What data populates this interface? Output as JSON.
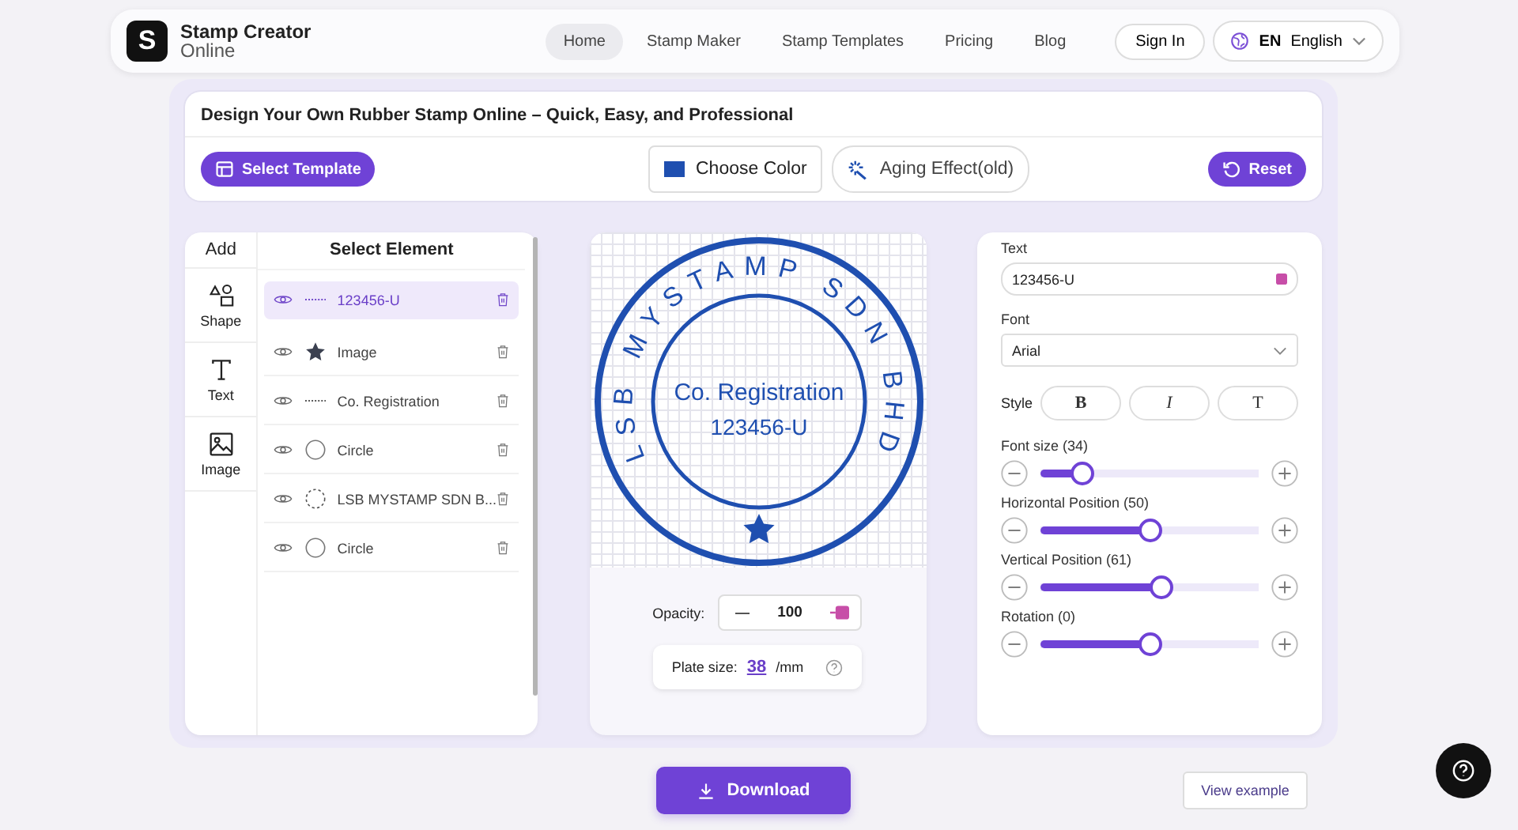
{
  "header": {
    "logo_letter": "S",
    "brand": "Stamp Creator",
    "brand_sub": "Online",
    "nav": [
      {
        "label": "Home",
        "selected": true
      },
      {
        "label": "Stamp Maker",
        "selected": false
      },
      {
        "label": "Stamp Templates",
        "selected": false
      },
      {
        "label": "Pricing",
        "selected": false
      },
      {
        "label": "Blog",
        "selected": false
      }
    ],
    "sign_in": "Sign In",
    "lang_code": "EN",
    "lang_name": "English"
  },
  "title": "Design Your Own Rubber Stamp Online – Quick, Easy, and Professional",
  "toolbar": {
    "select_template": "Select Template",
    "choose_color": "Choose Color",
    "color": "#1f4fb0",
    "aging": "Aging Effect(old)",
    "reset": "Reset"
  },
  "add_panel": {
    "title": "Add",
    "items": [
      {
        "kind": "shape",
        "label": "Shape"
      },
      {
        "kind": "text",
        "label": "Text"
      },
      {
        "kind": "image",
        "label": "Image"
      }
    ]
  },
  "elements": {
    "title": "Select Element",
    "items": [
      {
        "kind": "text",
        "label": "123456-U",
        "selected": true
      },
      {
        "kind": "star",
        "label": "Image",
        "selected": false
      },
      {
        "kind": "text",
        "label": "Co. Registration",
        "selected": false
      },
      {
        "kind": "circle",
        "label": "Circle",
        "selected": false
      },
      {
        "kind": "dashed-circle",
        "label": "LSB MYSTAMP SDN B...",
        "selected": false
      },
      {
        "kind": "circle",
        "label": "Circle",
        "selected": false
      }
    ]
  },
  "stamp": {
    "ring_text": "LSB MYSTAMP SDN BHD",
    "line1": "Co. Registration",
    "line2": "123456-U"
  },
  "opacity": {
    "label": "Opacity:",
    "value": "100"
  },
  "plate": {
    "label": "Plate size:",
    "value": "38",
    "unit": "/mm"
  },
  "props": {
    "text_label": "Text",
    "text_value": "123456-U",
    "font_label": "Font",
    "font_value": "Arial",
    "style_label": "Style",
    "styles": [
      {
        "kind": "bold",
        "label": "B"
      },
      {
        "kind": "italic",
        "label": "I"
      },
      {
        "kind": "plain",
        "label": "T"
      }
    ],
    "sliders": [
      {
        "label": "Font size (34)",
        "level": 0.19
      },
      {
        "label": "Horizontal Position (50)",
        "level": 0.5
      },
      {
        "label": "Vertical Position (61)",
        "level": 0.55
      },
      {
        "label": "Rotation (0)",
        "level": 0.5
      }
    ]
  },
  "download": "Download",
  "view_example": "View example"
}
